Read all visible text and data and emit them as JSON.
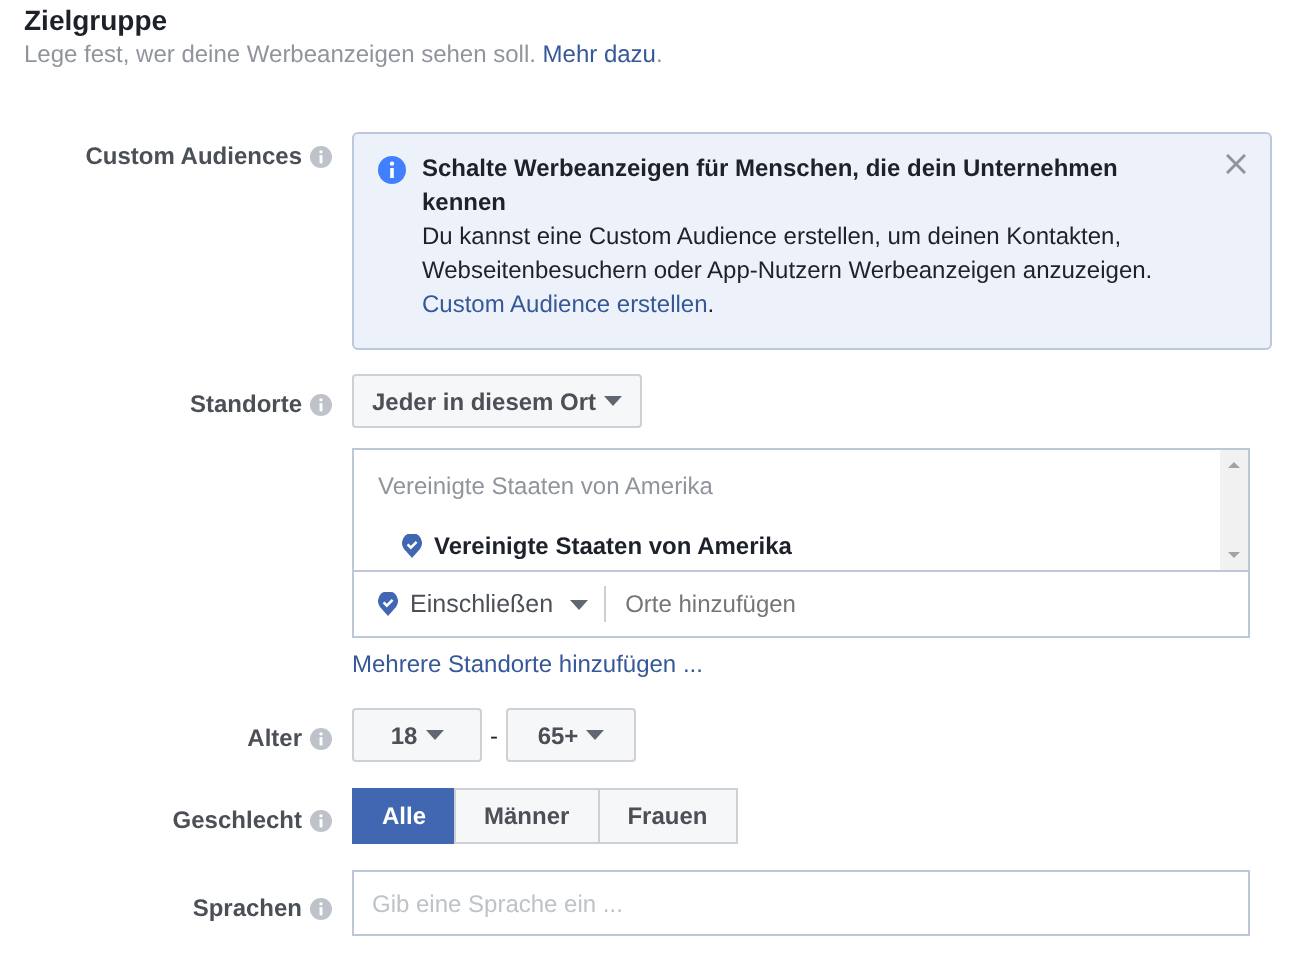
{
  "section": {
    "title": "Zielgruppe",
    "subtitle": "Lege fest, wer deine Werbeanzeigen sehen soll.",
    "subtitle_link": "Mehr dazu",
    "subtitle_end": "."
  },
  "custom_audiences": {
    "label": "Custom Audiences",
    "notice": {
      "title": "Schalte Werbeanzeigen für Menschen, die dein Unternehmen kennen",
      "body": "Du kannst eine Custom Audience erstellen, um deinen Kontakten, Webseitenbesuchern oder App-Nutzern Werbeanzeigen anzuzeigen.",
      "link": "Custom Audience erstellen",
      "link_end": "."
    }
  },
  "locations": {
    "label": "Standorte",
    "dropdown": "Jeder in diesem Ort",
    "group_heading": "Vereinigte Staaten von Amerika",
    "items": [
      "Vereinigte Staaten von Amerika"
    ],
    "mode": "Einschließen",
    "placeholder": "Orte hinzufügen",
    "add_link": "Mehrere Standorte hinzufügen ..."
  },
  "age": {
    "label": "Alter",
    "from": "18",
    "separator": "-",
    "to": "65+"
  },
  "gender": {
    "label": "Geschlecht",
    "options": [
      {
        "label": "Alle",
        "selected": true
      },
      {
        "label": "Männer",
        "selected": false
      },
      {
        "label": "Frauen",
        "selected": false
      }
    ]
  },
  "languages": {
    "label": "Sprachen",
    "placeholder": "Gib eine Sprache ein ..."
  }
}
